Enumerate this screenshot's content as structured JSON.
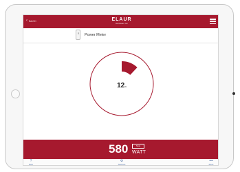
{
  "topbar": {
    "back_label": "BACK",
    "logo_brand": "ELAUR",
    "logo_sub": "Hardware Inc"
  },
  "device": {
    "title": "Power Meter"
  },
  "gauge": {
    "percent": 12,
    "unit": "%"
  },
  "reading": {
    "value": "580",
    "box_label": "Now",
    "unit": "WATT"
  },
  "tabbar": {
    "tabs": [
      {
        "icon": "help-icon",
        "label": "Help"
      },
      {
        "icon": "settings-icon",
        "label": "Settings"
      },
      {
        "icon": "more-icon",
        "label": "More"
      }
    ]
  },
  "colors": {
    "accent": "#a6192e"
  }
}
